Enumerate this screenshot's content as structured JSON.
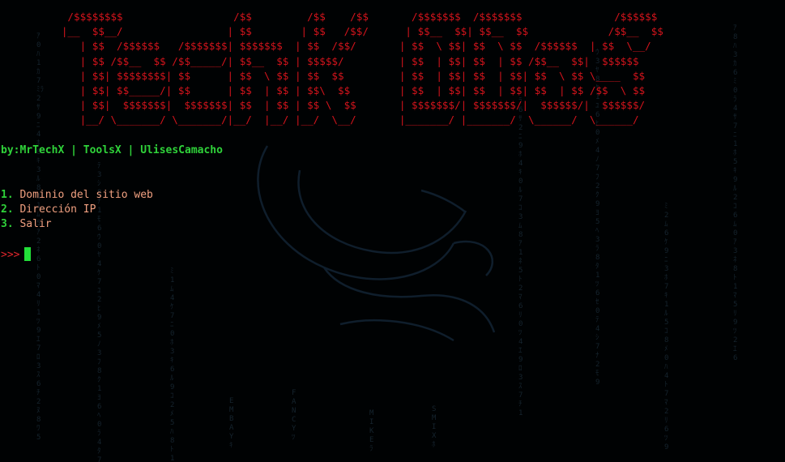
{
  "terminal": {
    "banner": [
      "           /$$$$$$$$                  /$$         /$$    /$$       /$$$$$$$  /$$$$$$$               /$$$$$$ ",
      "          |__  $$__/                 | $$        | $$   /$$/      | $$__  $$| $$__  $$             /$$__  $$",
      "             | $$  /$$$$$$   /$$$$$$$| $$$$$$$  | $$  /$$/       | $$  \\ $$| $$  \\ $$  /$$$$$$  | $$  \\__/",
      "             | $$ /$$__  $$ /$$_____/| $$__  $$ | $$$$$/         | $$  | $$| $$  | $$ /$$__  $$|  $$$$$$ ",
      "             | $$| $$$$$$$$| $$      | $$  \\ $$ | $$  $$         | $$  | $$| $$  | $$| $$  \\ $$ \\____  $$",
      "             | $$| $$_____/| $$      | $$  | $$ | $$\\  $$        | $$  | $$| $$  | $$| $$  | $$ /$$  \\ $$",
      "             | $$|  $$$$$$$|  $$$$$$$| $$  | $$ | $$ \\  $$       | $$$$$$$/| $$$$$$$/|  $$$$$$/|  $$$$$$/",
      "             |__/ \\_______/ \\_______/|__/  |__/ |__/  \\__/       |_______/ |_______/  \\______/  \\______/ "
    ],
    "credits": {
      "author": "by:MrTechX",
      "separator": " | ",
      "tool": "ToolsX",
      "separator2": " | ",
      "contributor": "UlisesCamacho"
    },
    "menu": [
      {
        "number": "1.",
        "label": "Dominio del sitio web"
      },
      {
        "number": "2.",
        "label": "Dirección IP"
      },
      {
        "number": "3.",
        "label": "Salir"
      }
    ],
    "prompt": {
      "symbol": ">>>"
    },
    "colors": {
      "background": "#000203",
      "banner": "#d4141c",
      "credits": "#2fd23a",
      "menu_number": "#2fd23a",
      "menu_label": "#f0a080",
      "prompt_symbol": "#e0262c",
      "cursor": "#22e03a"
    }
  }
}
